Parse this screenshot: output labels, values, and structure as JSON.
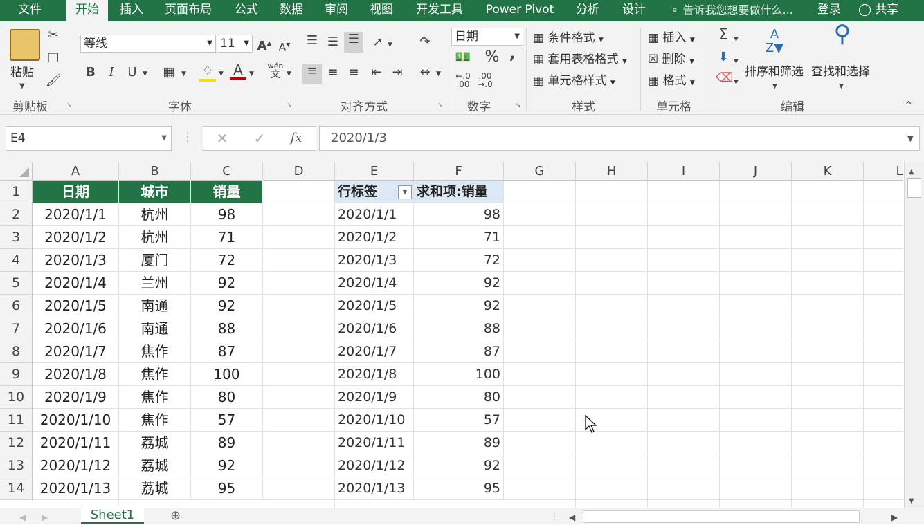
{
  "menu": {
    "tabs": [
      "文件",
      "开始",
      "插入",
      "页面布局",
      "公式",
      "数据",
      "审阅",
      "视图",
      "开发工具",
      "Power Pivot",
      "分析",
      "设计"
    ],
    "active": "开始",
    "tell_me": "告诉我您想要做什么...",
    "login": "登录",
    "share": "共享"
  },
  "ribbon": {
    "clipboard": {
      "label": "剪贴板",
      "paste": "粘贴"
    },
    "font": {
      "label": "字体",
      "name": "等线",
      "size": "11",
      "bold": "B",
      "italic": "I",
      "underline": "U",
      "phonetic": "wén"
    },
    "align": {
      "label": "对齐方式"
    },
    "number": {
      "label": "数字",
      "format": "日期",
      "percent": "%",
      "comma": ","
    },
    "styles": {
      "label": "样式",
      "cond": "条件格式",
      "table": "套用表格格式",
      "cell": "单元格样式"
    },
    "cells": {
      "label": "单元格",
      "insert": "插入",
      "delete": "删除",
      "format": "格式"
    },
    "editing": {
      "label": "编辑",
      "sort": "排序和筛选",
      "find": "查找和选择"
    }
  },
  "formula_bar": {
    "name_box": "E4",
    "fx": "fx",
    "formula": "2020/1/3"
  },
  "columns": [
    "A",
    "B",
    "C",
    "D",
    "E",
    "F",
    "G",
    "H",
    "I",
    "J",
    "K",
    "L"
  ],
  "rows": [
    "1",
    "2",
    "3",
    "4",
    "5",
    "6",
    "7",
    "8",
    "9",
    "10",
    "11",
    "12",
    "13",
    "14"
  ],
  "table": {
    "headers": [
      "日期",
      "城市",
      "销量"
    ],
    "rows": [
      [
        "2020/1/1",
        "杭州",
        "98"
      ],
      [
        "2020/1/2",
        "杭州",
        "71"
      ],
      [
        "2020/1/3",
        "厦门",
        "72"
      ],
      [
        "2020/1/4",
        "兰州",
        "92"
      ],
      [
        "2020/1/5",
        "南通",
        "92"
      ],
      [
        "2020/1/6",
        "南通",
        "88"
      ],
      [
        "2020/1/7",
        "焦作",
        "87"
      ],
      [
        "2020/1/8",
        "焦作",
        "100"
      ],
      [
        "2020/1/9",
        "焦作",
        "80"
      ],
      [
        "2020/1/10",
        "焦作",
        "57"
      ],
      [
        "2020/1/11",
        "荔城",
        "89"
      ],
      [
        "2020/1/12",
        "荔城",
        "92"
      ],
      [
        "2020/1/13",
        "荔城",
        "95"
      ]
    ]
  },
  "pivot": {
    "row_label": "行标签",
    "sum_label": "求和项:销量",
    "rows": [
      [
        "2020/1/1",
        "98"
      ],
      [
        "2020/1/2",
        "71"
      ],
      [
        "2020/1/3",
        "72"
      ],
      [
        "2020/1/4",
        "92"
      ],
      [
        "2020/1/5",
        "92"
      ],
      [
        "2020/1/6",
        "88"
      ],
      [
        "2020/1/7",
        "87"
      ],
      [
        "2020/1/8",
        "100"
      ],
      [
        "2020/1/9",
        "80"
      ],
      [
        "2020/1/10",
        "57"
      ],
      [
        "2020/1/11",
        "89"
      ],
      [
        "2020/1/12",
        "92"
      ],
      [
        "2020/1/13",
        "95"
      ]
    ]
  },
  "sheet": {
    "tab": "Sheet1"
  }
}
